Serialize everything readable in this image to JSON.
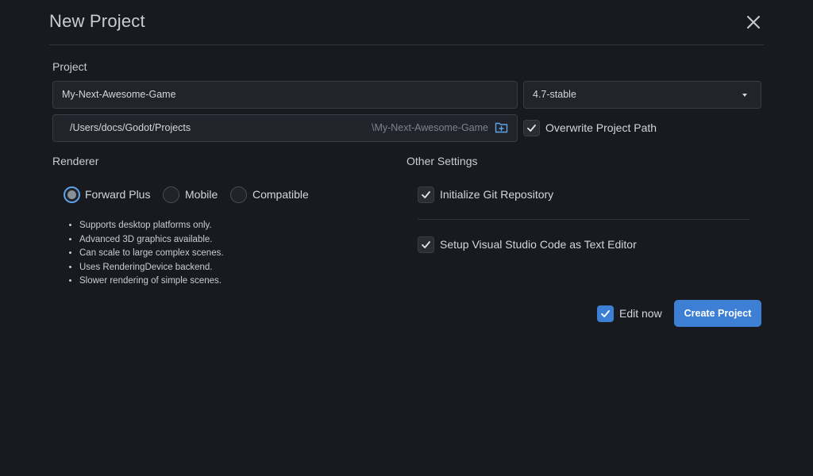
{
  "dialog": {
    "title": "New Project"
  },
  "project": {
    "section_label": "Project",
    "name_value": "My-Next-Awesome-Game",
    "version_value": "4.7-stable",
    "path_value": "/Users/docs/Godot/Projects",
    "path_suffix": "\\My-Next-Awesome-Game",
    "overwrite_label": "Overwrite Project Path",
    "overwrite_checked": true
  },
  "renderer": {
    "section_label": "Renderer",
    "options": [
      {
        "label": "Forward Plus",
        "selected": true
      },
      {
        "label": "Mobile",
        "selected": false
      },
      {
        "label": "Compatible",
        "selected": false
      }
    ],
    "features": [
      "Supports desktop platforms only.",
      "Advanced 3D graphics available.",
      "Can scale to large complex scenes.",
      "Uses RenderingDevice backend.",
      "Slower rendering of simple scenes."
    ]
  },
  "other_settings": {
    "section_label": "Other Settings",
    "git_label": "Initialize Git Repository",
    "git_checked": true,
    "vscode_label": "Setup Visual Studio Code as Text Editor",
    "vscode_checked": true
  },
  "footer": {
    "edit_now_label": "Edit now",
    "edit_now_checked": true,
    "create_label": "Create Project"
  },
  "colors": {
    "background": "#181a20",
    "field_bg": "#21242b",
    "accent": "#3d7fd4",
    "radio_selected_ring": "#5da4ea"
  },
  "icons": {
    "close": "close-icon",
    "folder": "folder-plus-icon",
    "dropdown": "chevron-down-icon",
    "check": "check-icon"
  }
}
